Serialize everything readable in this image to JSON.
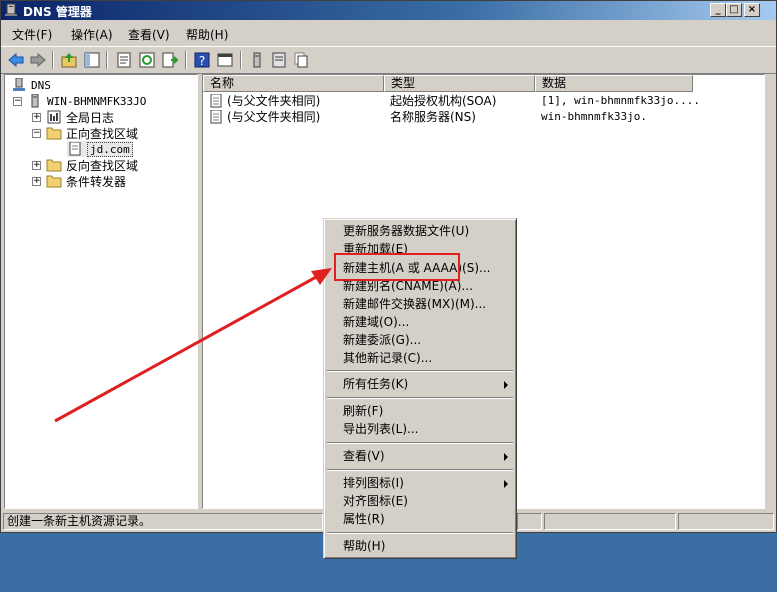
{
  "window": {
    "title": "DNS 管理器",
    "minimize": "_",
    "maximize": "□",
    "close": "×"
  },
  "menubar": [
    "文件(F)",
    "操作(A)",
    "查看(V)",
    "帮助(H)"
  ],
  "toolbar": [
    "back-arrow-icon",
    "forward-arrow-icon",
    "up-folder-icon",
    "show-hide-tree-icon",
    "properties-icon",
    "refresh-icon",
    "export-list-icon",
    "help-icon",
    "console-icon",
    "server-icon",
    "list-icon",
    "copy-icon"
  ],
  "tree": {
    "root": "DNS",
    "server": "WIN-BHMNMFK33JO",
    "global_logs": "全局日志",
    "forward_zones": "正向查找区域",
    "zone": "jd.com",
    "reverse_zones": "反向查找区域",
    "conditional_forwarders": "条件转发器",
    "expand_plus": "+",
    "expand_minus": "−"
  },
  "list": {
    "headers": {
      "name": "名称",
      "type": "类型",
      "data": "数据"
    },
    "rows": [
      {
        "name": "(与父文件夹相同)",
        "type": "起始授权机构(SOA)",
        "data": "[1], win-bhmnmfk33jo...."
      },
      {
        "name": "(与父文件夹相同)",
        "type": "名称服务器(NS)",
        "data": "win-bhmnmfk33jo."
      }
    ]
  },
  "status": {
    "text": "创建一条新主机资源记录。"
  },
  "context_menu": {
    "update_server_data": "更新服务器数据文件(U)",
    "reload": "重新加载(E)",
    "new_host": "新建主机(A 或 AAAA)(S)...",
    "new_alias": "新建别名(CNAME)(A)...",
    "new_mail_exchanger": "新建邮件交换器(MX)(M)...",
    "new_domain": "新建域(O)...",
    "new_delegation": "新建委派(G)...",
    "other_new_records": "其他新记录(C)...",
    "all_tasks": "所有任务(K)",
    "refresh": "刷新(F)",
    "export_list": "导出列表(L)...",
    "view": "查看(V)",
    "arrange_icons": "排列图标(I)",
    "line_up_icons": "对齐图标(E)",
    "properties": "属性(R)",
    "help": "帮助(H)"
  },
  "colors": {
    "annotation_red": "#e02020",
    "titlebar_start": "#0a246a",
    "desktop": "#3a6ea5"
  }
}
